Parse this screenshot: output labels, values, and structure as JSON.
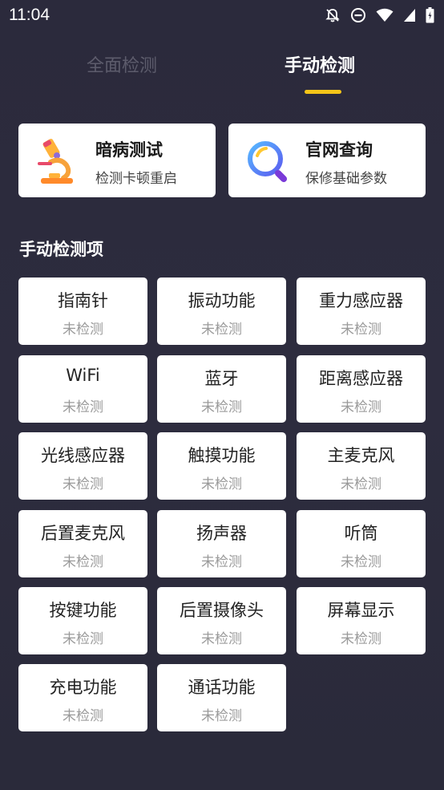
{
  "status_bar": {
    "time": "11:04"
  },
  "tabs": [
    {
      "label": "全面检测",
      "active": false
    },
    {
      "label": "手动检测",
      "active": true
    }
  ],
  "cards": [
    {
      "title": "暗病测试",
      "subtitle": "检测卡顿重启",
      "icon": "microscope-icon"
    },
    {
      "title": "官网查询",
      "subtitle": "保修基础参数",
      "icon": "magnifier-icon"
    }
  ],
  "section_title": "手动检测项",
  "items": [
    {
      "name": "指南针",
      "status": "未检测"
    },
    {
      "name": "振动功能",
      "status": "未检测"
    },
    {
      "name": "重力感应器",
      "status": "未检测"
    },
    {
      "name": "WiFi",
      "status": "未检测"
    },
    {
      "name": "蓝牙",
      "status": "未检测"
    },
    {
      "name": "距离感应器",
      "status": "未检测"
    },
    {
      "name": "光线感应器",
      "status": "未检测"
    },
    {
      "name": "触摸功能",
      "status": "未检测"
    },
    {
      "name": "主麦克风",
      "status": "未检测"
    },
    {
      "name": "后置麦克风",
      "status": "未检测"
    },
    {
      "name": "扬声器",
      "status": "未检测"
    },
    {
      "name": "听筒",
      "status": "未检测"
    },
    {
      "name": "按键功能",
      "status": "未检测"
    },
    {
      "name": "后置摄像头",
      "status": "未检测"
    },
    {
      "name": "屏幕显示",
      "status": "未检测"
    },
    {
      "name": "充电功能",
      "status": "未检测"
    },
    {
      "name": "通话功能",
      "status": "未检测"
    }
  ],
  "colors": {
    "accent": "#f5c518",
    "background": "#2b2a3c",
    "card": "#ffffff",
    "inactive_tab": "#5d5c6c"
  }
}
